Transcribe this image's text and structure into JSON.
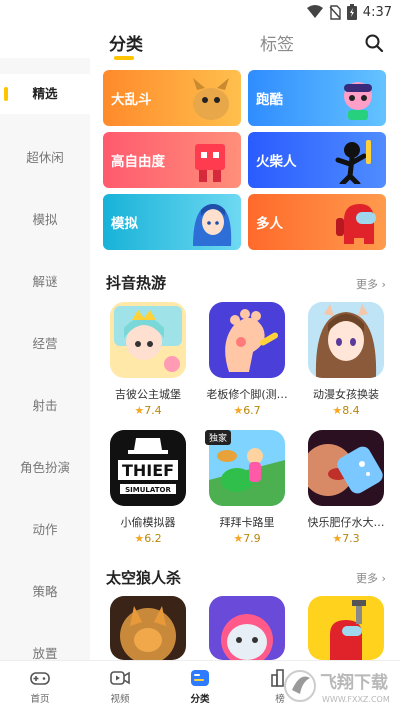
{
  "status_bar": {
    "time": "4:37"
  },
  "header": {
    "tabs": [
      "分类",
      "标签"
    ],
    "active_tab": 0
  },
  "sidebar": {
    "items": [
      "精选",
      "超休闲",
      "模拟",
      "解谜",
      "经营",
      "射击",
      "角色扮演",
      "动作",
      "策略",
      "放置"
    ],
    "active": 0
  },
  "categories": [
    {
      "label": "大乱斗",
      "color_from": "#ff8a2b",
      "color_to": "#ffc04d"
    },
    {
      "label": "跑酷",
      "color_from": "#2f8cff",
      "color_to": "#64c3ff"
    },
    {
      "label": "高自由度",
      "color_from": "#ff5a6e",
      "color_to": "#ff8f7a"
    },
    {
      "label": "火柴人",
      "color_from": "#2a5bff",
      "color_to": "#4f8dff"
    },
    {
      "label": "模拟",
      "color_from": "#18b2d8",
      "color_to": "#6fd9f2"
    },
    {
      "label": "多人",
      "color_from": "#ff6a2b",
      "color_to": "#ff9b4d"
    }
  ],
  "sections": [
    {
      "title": "抖音热游",
      "more": "更多",
      "games": [
        {
          "name": "吉彼公主城堡",
          "rating": "7.4",
          "badge": ""
        },
        {
          "name": "老板修个脚(测…",
          "rating": "6.7",
          "badge": ""
        },
        {
          "name": "动漫女孩换装",
          "rating": "8.4",
          "badge": ""
        },
        {
          "name": "小偷模拟器",
          "rating": "6.2",
          "badge": ""
        },
        {
          "name": "拜拜卡路里",
          "rating": "7.9",
          "badge": "独家"
        },
        {
          "name": "快乐肥仔水大…",
          "rating": "7.3",
          "badge": ""
        }
      ]
    },
    {
      "title": "太空狼人杀",
      "more": "更多"
    }
  ],
  "game_icon_text": {
    "thief": "THIEF",
    "thief_sub": "SIMULATOR"
  },
  "bottom_nav": {
    "items": [
      "首页",
      "视频",
      "分类",
      "榜"
    ],
    "active": 2
  },
  "watermark": {
    "text": "飞翔下载",
    "sub": "WWW.FXXZ.COM"
  },
  "colors": {
    "accent": "#ffc400",
    "star": "#f5a623"
  }
}
